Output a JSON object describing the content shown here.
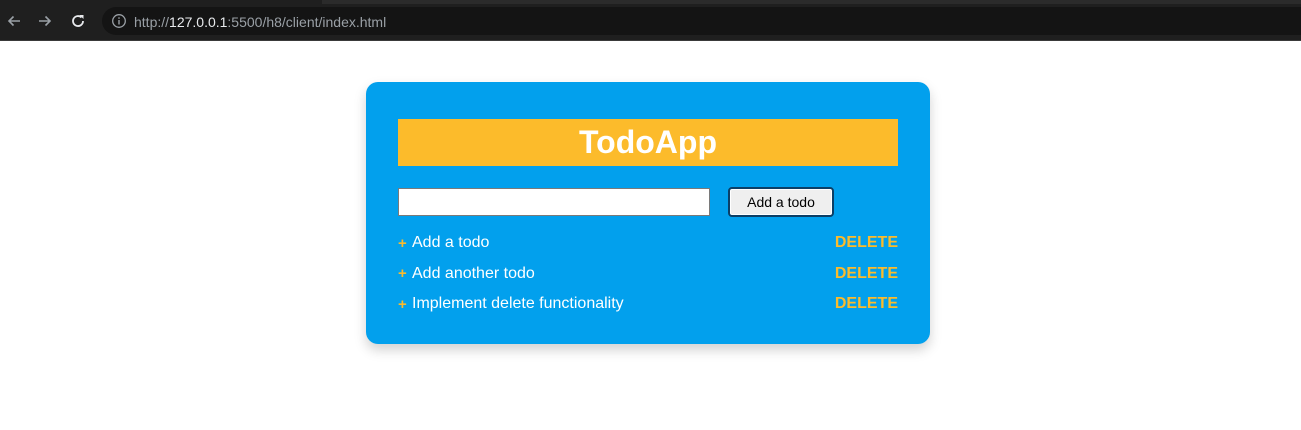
{
  "browser": {
    "url_prefix": "http://",
    "url_host": "127.0.0.1",
    "url_rest": ":5500/h8/client/index.html",
    "icons": {
      "back": "arrow-left-icon",
      "forward": "arrow-right-icon",
      "reload": "reload-icon",
      "info": "info-icon"
    }
  },
  "app": {
    "title": "TodoApp",
    "input": {
      "value": "",
      "placeholder": ""
    },
    "add_button_label": "Add a todo",
    "todos": [
      {
        "marker": "+",
        "text": "Add a todo",
        "delete_label": "DELETE"
      },
      {
        "marker": "+",
        "text": "Add another todo",
        "delete_label": "DELETE"
      },
      {
        "marker": "+",
        "text": "Implement delete functionality",
        "delete_label": "DELETE"
      }
    ]
  },
  "colors": {
    "card_background": "#02a0ed",
    "accent_yellow": "#fcbb2b",
    "title_text": "#ffffff",
    "chrome_background": "#1f1f1f"
  }
}
